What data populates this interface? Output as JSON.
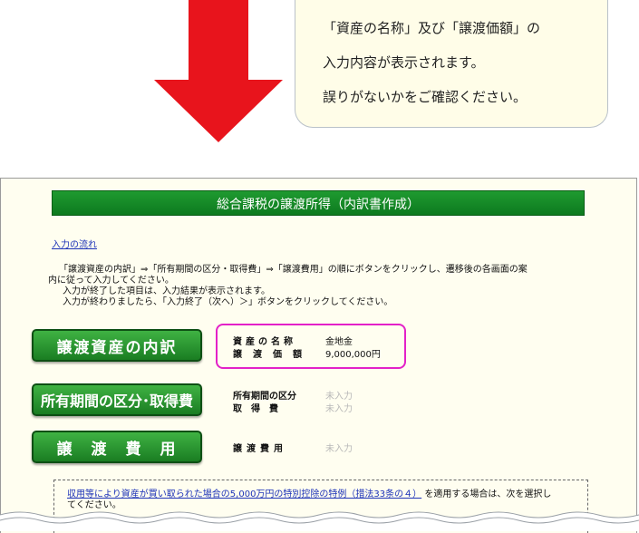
{
  "callout": {
    "line1": "「資産の名称」及び「譲渡価額」の",
    "line2": "入力内容が表示されます。",
    "line3": "誤りがないかをご確認ください。"
  },
  "panel": {
    "title": "総合課税の譲渡所得（内訳書作成）",
    "flow_link": "入力の流れ",
    "instructions": [
      "「譲渡資産の内訳」⇒「所有期間の区分・取得費」⇒「譲渡費用」の順にボタンをクリックし、遷移後の各画面の案",
      "内に従って入力してください。",
      "入力が終了した項目は、入力結果が表示されます。",
      "入力が終わりましたら、「入力終了（次へ）＞」ボタンをクリックしてください。"
    ],
    "buttons": {
      "asset_breakdown": "譲渡資産の内訳",
      "holding_period": "所有期間の区分･取得費",
      "transfer_cost": "譲　渡　費　用"
    },
    "asset_info": {
      "name_label": "資産の名称",
      "name_value": "金地金",
      "price_label": "譲渡価額",
      "price_value": "9,000,000円"
    },
    "period_info": {
      "period_label": "所有期間の区分",
      "period_value": "未入力",
      "cost_label": "取　得　費",
      "cost_value": "未入力"
    },
    "transfer_info": {
      "label": "譲渡費用",
      "value": "未入力"
    },
    "special_note": {
      "link": "収用等により資産が買い取られた場合の5,000万円の特別控除の特例（措法33条の４）",
      "text_after": "を適用する場合は、次を選択し",
      "text_line2": "てください。"
    }
  },
  "colors": {
    "arrow": "#e8141c",
    "header_bar": "#12862a",
    "button_green": "#1f8a2a",
    "highlight_border": "#e321c8",
    "link": "#1d33b8"
  }
}
